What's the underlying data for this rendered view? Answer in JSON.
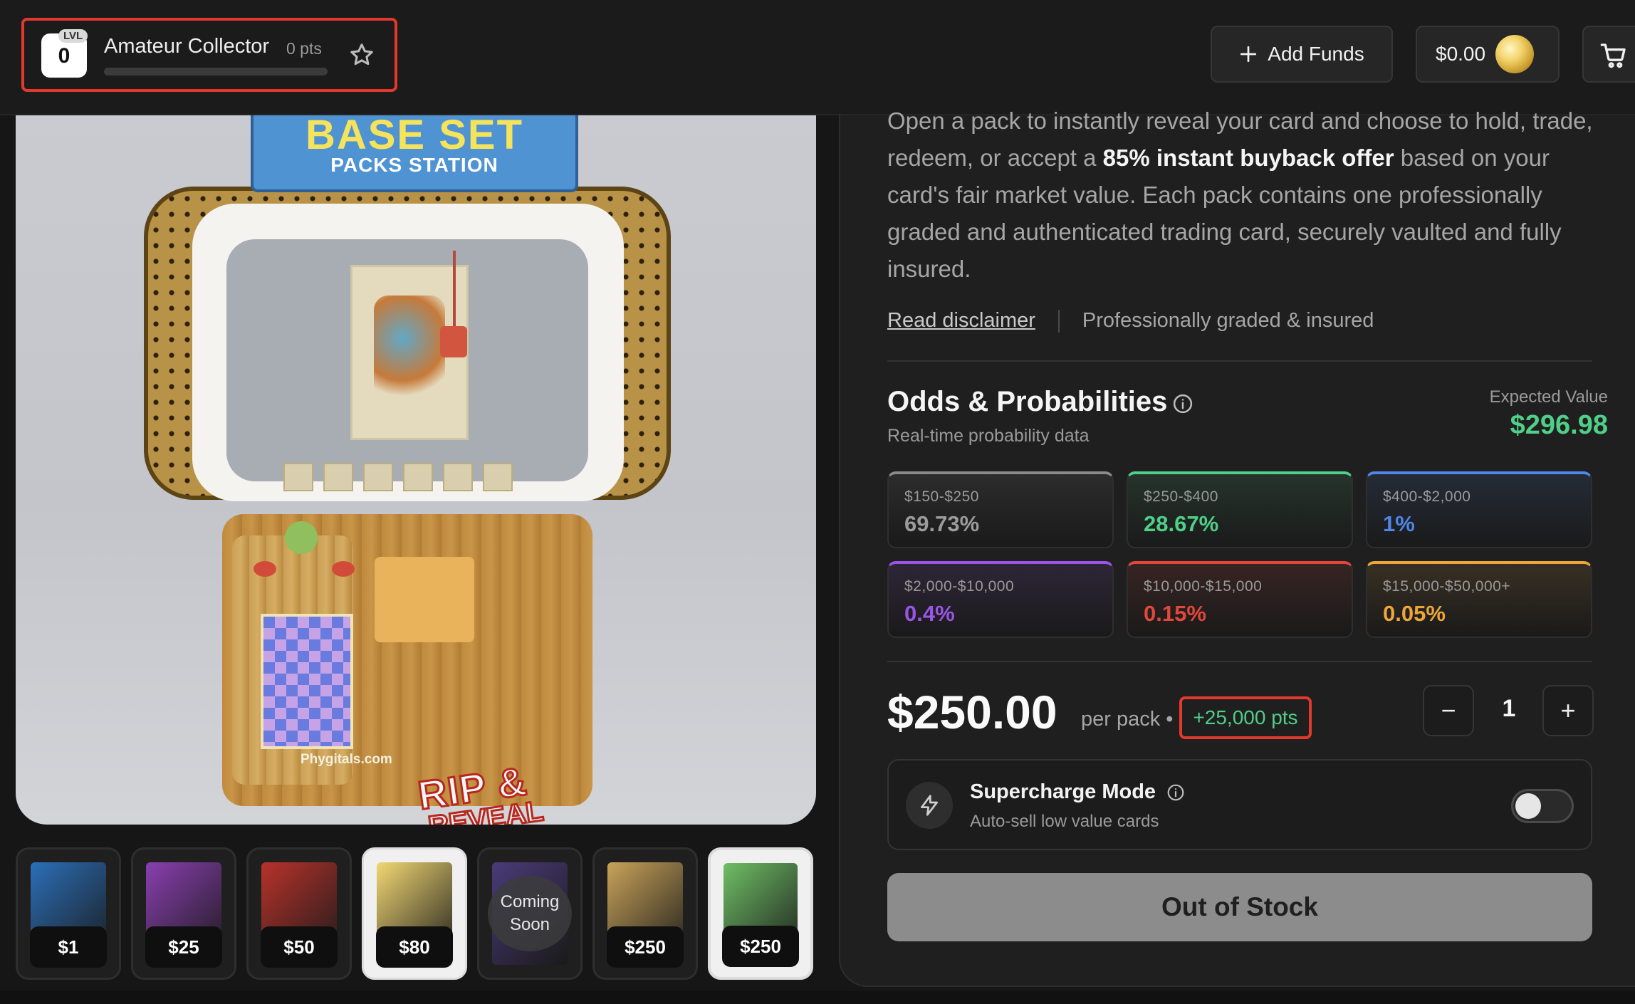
{
  "header": {
    "level_tag": "LVL",
    "level_number": "0",
    "level_title": "Amateur Collector",
    "level_points": "0 pts",
    "level_progress": 0,
    "add_funds_label": "Add Funds",
    "balance": "$0.00",
    "icons": [
      "star-icon",
      "plus-icon",
      "coin-icon",
      "cart-icon"
    ]
  },
  "product_image": {
    "sign_line1": "BASE SET",
    "sign_line2": "PACKS STATION",
    "rip_line1": "RIP &",
    "rip_line2": "REVEAL",
    "brand": "Phygitals.com"
  },
  "thumbnails": [
    {
      "price": "$1",
      "art": "#2b6fb8"
    },
    {
      "price": "$25",
      "art": "#8a3fb0"
    },
    {
      "price": "$50",
      "art": "#b8322b"
    },
    {
      "price": "$80",
      "art": "#f2d873"
    },
    {
      "price": "",
      "coming_soon": "Coming Soon",
      "art": "#4a3b7a"
    },
    {
      "price": "$250",
      "art": "#c9a35a"
    },
    {
      "price": "$250",
      "art": "#6fbf66"
    }
  ],
  "description": {
    "part1": "Open a pack to instantly reveal your card and choose to hold, trade, redeem, or accept a ",
    "bold": "85% instant buyback offer",
    "part2": " based on your card's fair market value. Each pack contains one professionally graded and authenticated trading card, securely vaulted and fully insured."
  },
  "links": {
    "disclaimer": "Read disclaimer",
    "graded": "Professionally graded & insured"
  },
  "odds": {
    "title": "Odds & Probabilities",
    "subtitle": "Real-time probability data",
    "ev_label": "Expected Value",
    "ev_value": "$296.98",
    "tiers": [
      {
        "range": "$150-$250",
        "pct": "69.73%",
        "color": "#8a8a8a"
      },
      {
        "range": "$250-$400",
        "pct": "28.67%",
        "color": "#4fcf88"
      },
      {
        "range": "$400-$2,000",
        "pct": "1%",
        "color": "#4f86e8"
      },
      {
        "range": "$2,000-$10,000",
        "pct": "0.4%",
        "color": "#9a55e8"
      },
      {
        "range": "$10,000-$15,000",
        "pct": "0.15%",
        "color": "#e2473b"
      },
      {
        "range": "$15,000-$50,000+",
        "pct": "0.05%",
        "color": "#eea63a"
      }
    ]
  },
  "purchase": {
    "price": "$250.00",
    "per_pack": "per pack •",
    "points": "+25,000 pts",
    "minus": "−",
    "plus": "+",
    "quantity": "1"
  },
  "supercharge": {
    "title": "Supercharge Mode",
    "subtitle": "Auto-sell low value cards",
    "enabled": false
  },
  "cta": {
    "label": "Out of Stock"
  }
}
